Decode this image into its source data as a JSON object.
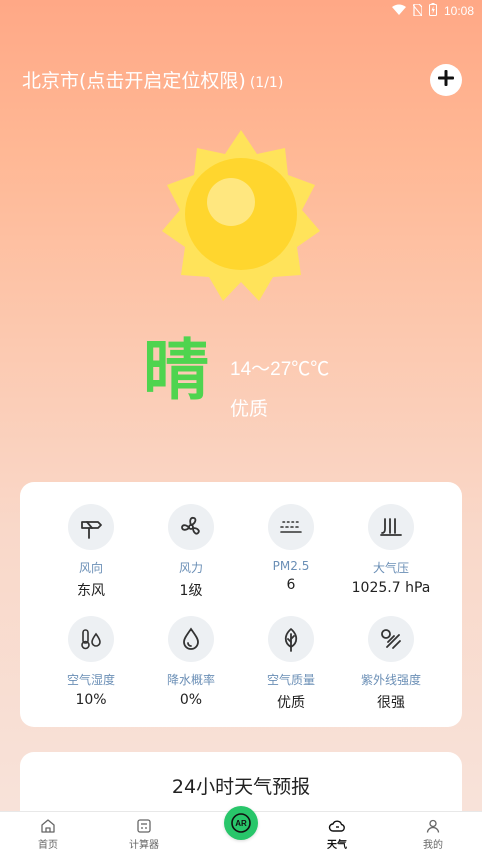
{
  "status_bar": {
    "time": "10:08"
  },
  "header": {
    "city": "北京市(点击开启定位权限)",
    "page_count": "(1/1)",
    "add_label": "+"
  },
  "weather": {
    "condition": "晴",
    "temperature": "14～27℃℃",
    "air_quality": "优质"
  },
  "details": [
    {
      "icon": "wind-direction-icon",
      "label": "风向",
      "value": "东风"
    },
    {
      "icon": "fan-icon",
      "label": "风力",
      "value": "1级"
    },
    {
      "icon": "pm25-icon",
      "label": "PM2.5",
      "value": "6"
    },
    {
      "icon": "pressure-icon",
      "label": "大气压",
      "value": "1025.7 hPa"
    },
    {
      "icon": "humidity-icon",
      "label": "空气湿度",
      "value": "10%"
    },
    {
      "icon": "raindrop-icon",
      "label": "降水概率",
      "value": "0%"
    },
    {
      "icon": "leaf-icon",
      "label": "空气质量",
      "value": "优质"
    },
    {
      "icon": "uv-icon",
      "label": "紫外线强度",
      "value": "很强"
    }
  ],
  "forecast": {
    "title": "24小时天气预报"
  },
  "tabs": [
    {
      "label": "首页",
      "icon": "home-icon"
    },
    {
      "label": "计算器",
      "icon": "calculator-icon"
    },
    {
      "label": "AR",
      "icon": "ar-icon"
    },
    {
      "label": "天气",
      "icon": "cloud-icon",
      "active": true
    },
    {
      "label": "我的",
      "icon": "profile-icon"
    }
  ],
  "colors": {
    "accent_green": "#4fd44f",
    "label_blue": "#6b8fb6",
    "sun_yellow": "#ffe35a",
    "ar_green": "#28c66a"
  }
}
